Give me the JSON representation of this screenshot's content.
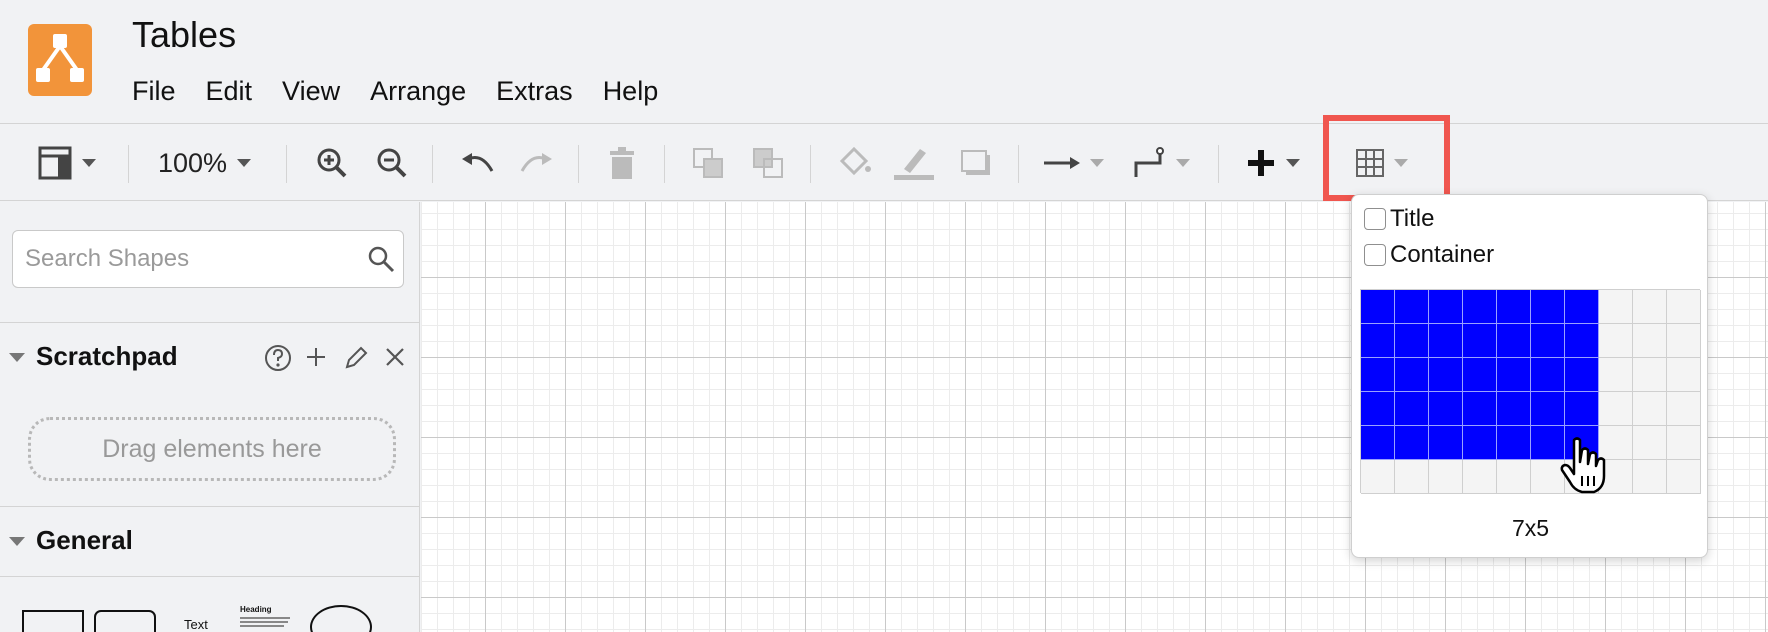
{
  "app": {
    "title": "Tables"
  },
  "menu": [
    "File",
    "Edit",
    "View",
    "Arrange",
    "Extras",
    "Help"
  ],
  "toolbar": {
    "zoom_label": "100%",
    "icons": [
      "format-panel-icon",
      "zoom-in-icon",
      "zoom-out-icon",
      "undo-icon",
      "redo-icon",
      "delete-icon",
      "to-front-icon",
      "to-back-icon",
      "fill-color-icon",
      "line-color-icon",
      "shadow-icon",
      "connection-icon",
      "waypoints-icon",
      "insert-plus-icon",
      "table-icon"
    ],
    "highlight_color": "#f0564f"
  },
  "sidebar": {
    "search_placeholder": "Search Shapes",
    "scratchpad_title": "Scratchpad",
    "dropzone_text": "Drag elements here",
    "general_title": "General",
    "shape_labels": {
      "text": "Text",
      "heading": "Heading"
    }
  },
  "table_popup": {
    "options": [
      {
        "label": "Title",
        "checked": false
      },
      {
        "label": "Container",
        "checked": false
      }
    ],
    "selected_columns": 7,
    "selected_rows": 5,
    "grid_columns": 10,
    "grid_rows": 6,
    "size_label": "7x5",
    "selected_color": "#0000ff"
  },
  "colors": {
    "logo": "#f2943a",
    "background": "#f1f2f4"
  }
}
